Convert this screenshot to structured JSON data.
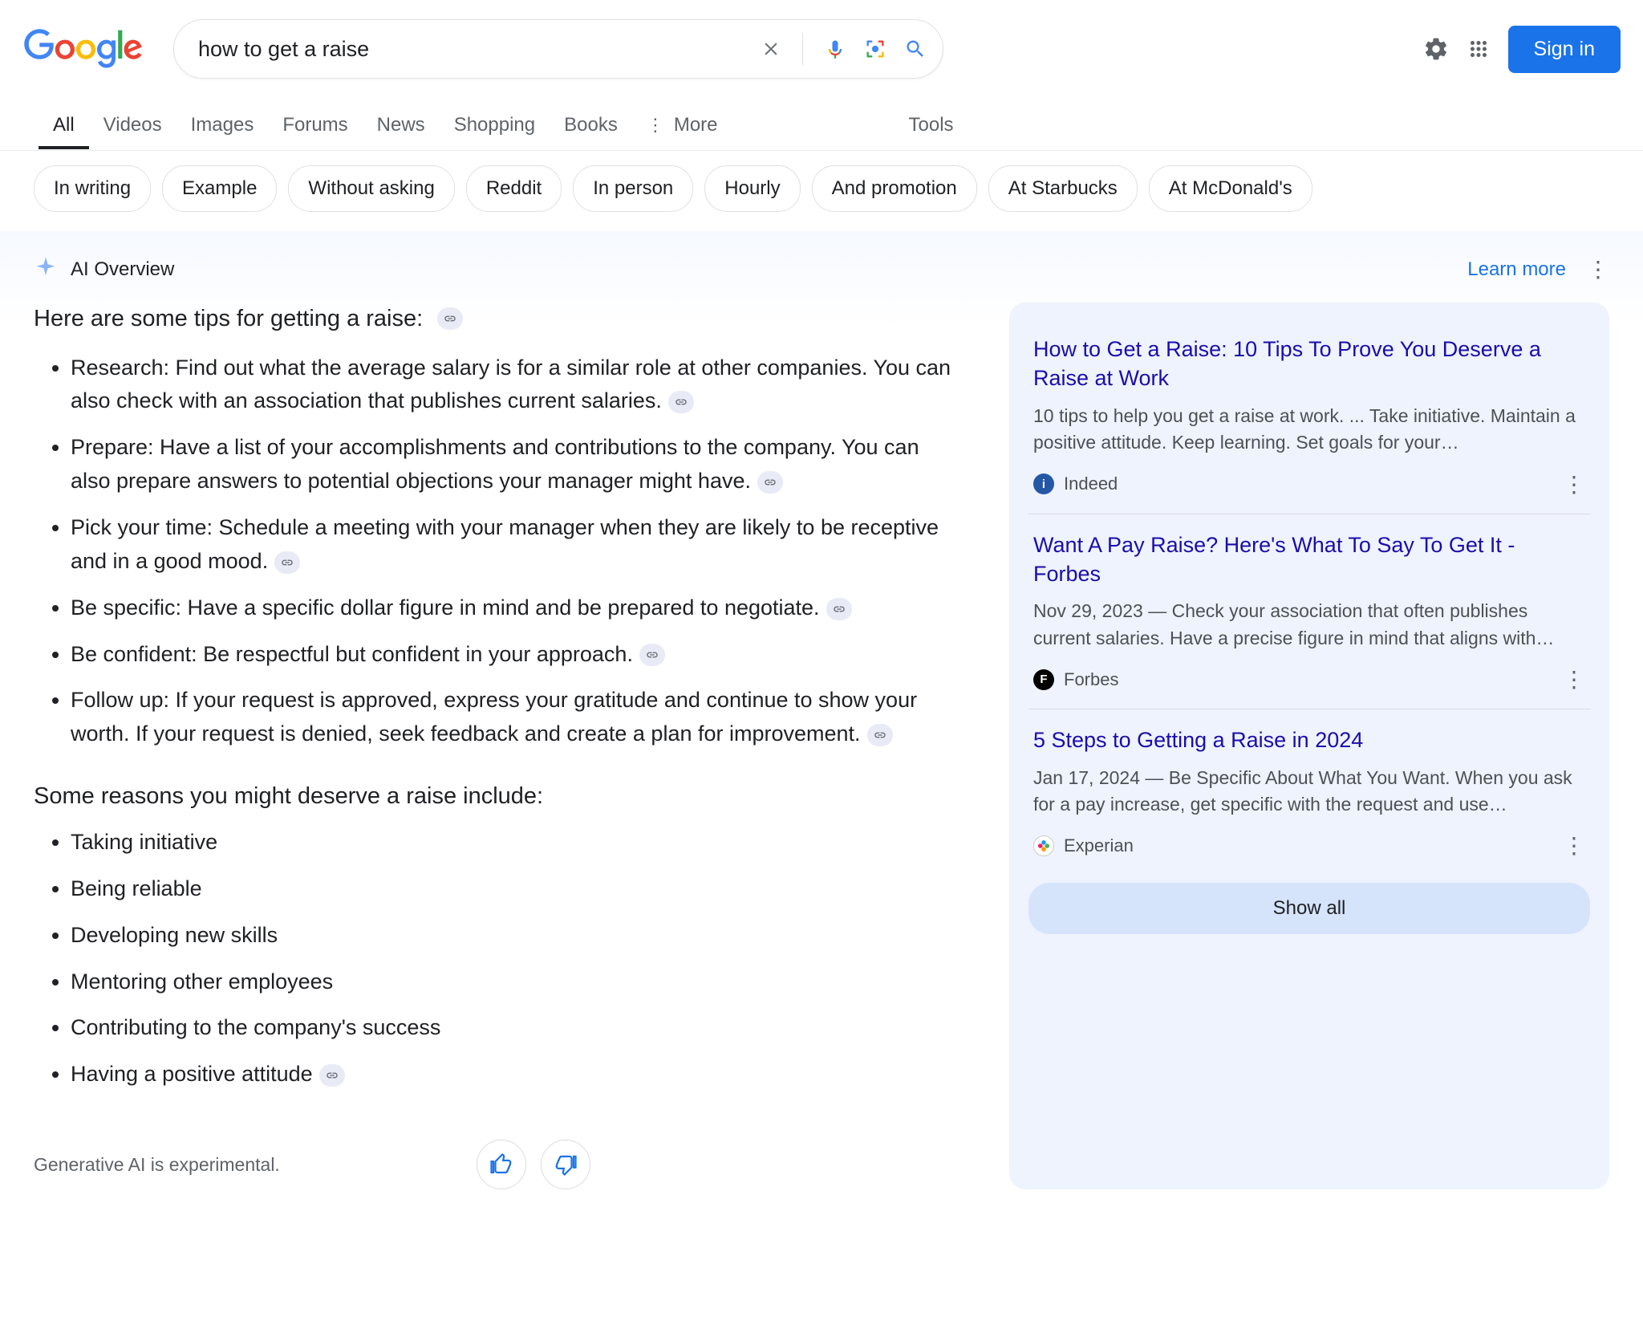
{
  "search": {
    "query": "how to get a raise"
  },
  "header": {
    "sign_in": "Sign in"
  },
  "tabs": {
    "items": [
      "All",
      "Videos",
      "Images",
      "Forums",
      "News",
      "Shopping",
      "Books"
    ],
    "more": "More",
    "tools": "Tools"
  },
  "chips": [
    "In writing",
    "Example",
    "Without asking",
    "Reddit",
    "In person",
    "Hourly",
    "And promotion",
    "At Starbucks",
    "At McDonald's"
  ],
  "ai": {
    "title": "AI Overview",
    "learn_more": "Learn more",
    "intro": "Here are some tips for getting a raise:",
    "tips": [
      "Research: Find out what the average salary is for a similar role at other companies. You can also check with an association that publishes current salaries.",
      "Prepare: Have a list of your accomplishments and contributions to the company. You can also prepare answers to potential objections your manager might have.",
      "Pick your time: Schedule a meeting with your manager when they are likely to be receptive and in a good mood.",
      "Be specific: Have a specific dollar figure in mind and be prepared to negotiate.",
      "Be confident: Be respectful but confident in your approach.",
      "Follow up: If your request is approved, express your gratitude and continue to show your worth. If your request is denied, seek feedback and create a plan for improvement."
    ],
    "reasons_heading": "Some reasons you might deserve a raise include:",
    "reasons": [
      "Taking initiative",
      "Being reliable",
      "Developing new skills",
      "Mentoring other employees",
      "Contributing to the company's success",
      "Having a positive attitude"
    ],
    "disclaimer": "Generative AI is experimental."
  },
  "cards": [
    {
      "title": "How to Get a Raise: 10 Tips To Prove You Deserve a Raise at Work",
      "snippet": "10 tips to help you get a raise at work. ... Take initiative. Maintain a positive attitude. Keep learning. Set goals for your…",
      "source": "Indeed"
    },
    {
      "title": "Want A Pay Raise? Here's What To Say To Get It - Forbes",
      "snippet": "Nov 29, 2023 — Check your association that often publishes current salaries. Have a precise figure in mind that aligns with…",
      "source": "Forbes"
    },
    {
      "title": "5 Steps to Getting a Raise in 2024",
      "snippet": "Jan 17, 2024 — Be Specific About What You Want. When you ask for a pay increase, get specific with the request and use…",
      "source": "Experian"
    }
  ],
  "show_all": "Show all"
}
